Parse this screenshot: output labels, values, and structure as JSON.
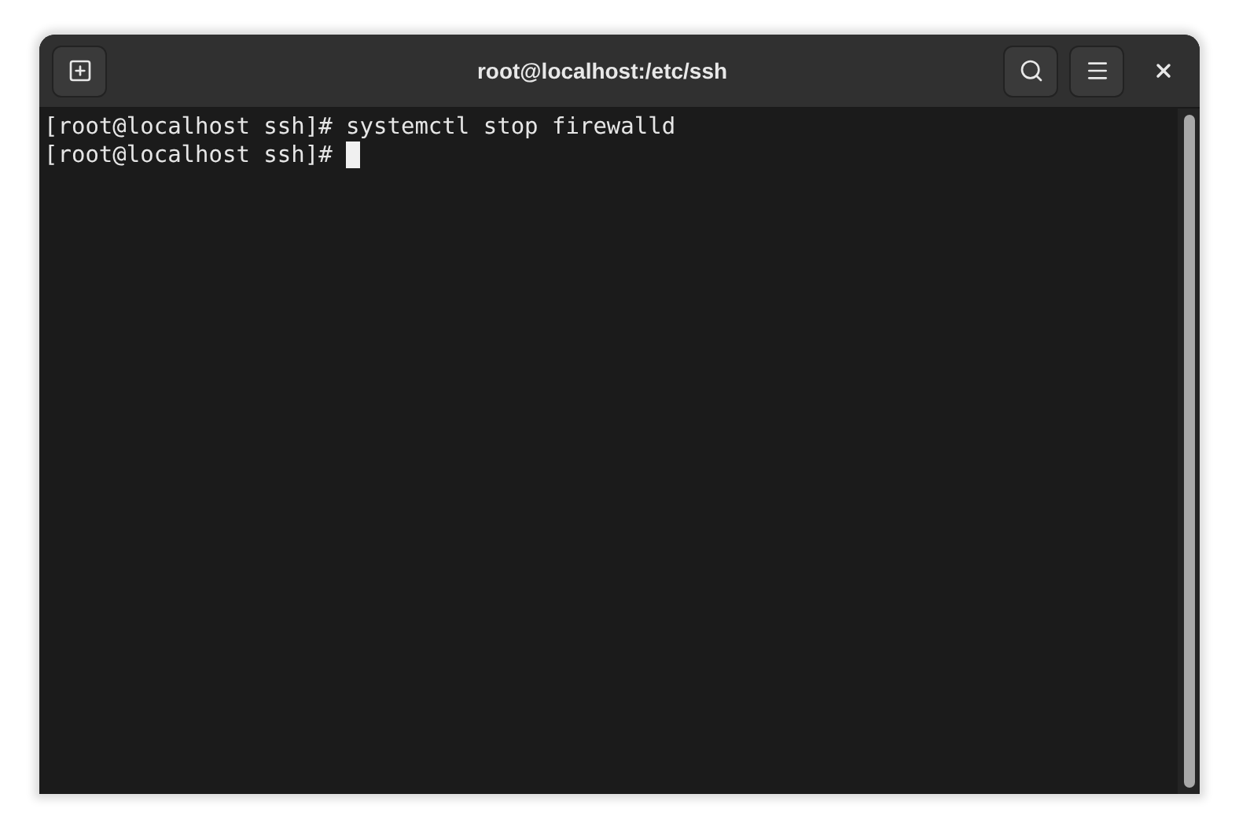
{
  "window": {
    "title": "root@localhost:/etc/ssh"
  },
  "terminal": {
    "lines": [
      {
        "prompt": "[root@localhost ssh]#",
        "command": "systemctl stop firewalld",
        "cursor": false
      },
      {
        "prompt": "[root@localhost ssh]#",
        "cursor": true
      }
    ]
  }
}
